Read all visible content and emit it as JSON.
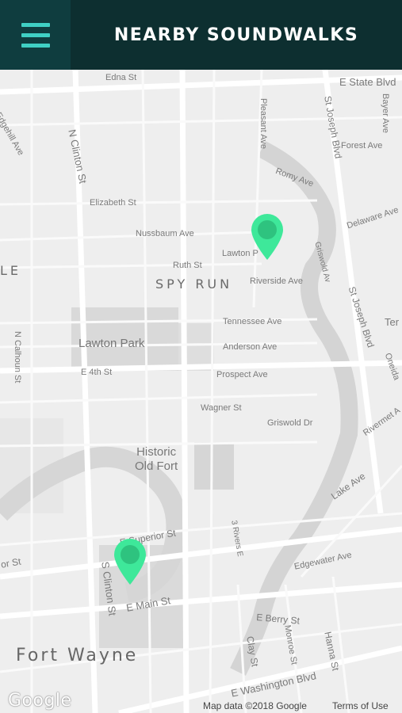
{
  "header": {
    "title": "NEARBY SOUNDWALKS"
  },
  "map": {
    "streets": {
      "edna": "Edna St",
      "e_state": "E State Blvd",
      "edgehill": "Edgehill Ave",
      "pleasant": "Pleasant Ave",
      "st_joseph_top": "St Joseph Blvd",
      "bayer": "Bayer Ave",
      "forest": "Forest Ave",
      "n_clinton": "N Clinton St",
      "romy": "Romy Ave",
      "elizabeth": "Elizabeth St",
      "delaware": "Delaware Ave",
      "nussbaum": "Nussbaum Ave",
      "lawton_pl": "Lawton P",
      "ruth": "Ruth St",
      "griswold_ave": "Griswold Av",
      "riverside": "Riverside Ave",
      "st_joseph_right": "St Joseph Blvd",
      "tennessee": "Tennessee Ave",
      "anderson": "Anderson Ave",
      "n_calhoun": "N Calhoun St",
      "e_4th": "E 4th St",
      "prospect": "Prospect Ave",
      "oneida": "Oneida",
      "wagner": "Wagner St",
      "griswold_dr": "Griswold Dr",
      "rivermet": "Rivermet A",
      "lake": "Lake Ave",
      "superior": "E Superior St",
      "or_st": "or St",
      "three_rivers": "3 Rivers E",
      "s_clinton": "S Clinton St",
      "edgewater": "Edgewater Ave",
      "e_main": "E Main St",
      "e_berry": "E Berry St",
      "clay": "Clay St",
      "monroe": "Monroe St",
      "hanna": "Hanna St",
      "e_washington": "E Washington Blvd",
      "ter": "Ter"
    },
    "areas": {
      "spy_run": "SPY RUN",
      "le": "LE",
      "lawton_park": "Lawton Park",
      "historic_old_fort": "Historic\nOld Fort",
      "fort_wayne": "Fort Wayne"
    },
    "attribution": {
      "logo": "Google",
      "map_data": "Map data ©2018 Google",
      "terms": "Terms of Use"
    },
    "pin_color": "#3ee89a"
  }
}
